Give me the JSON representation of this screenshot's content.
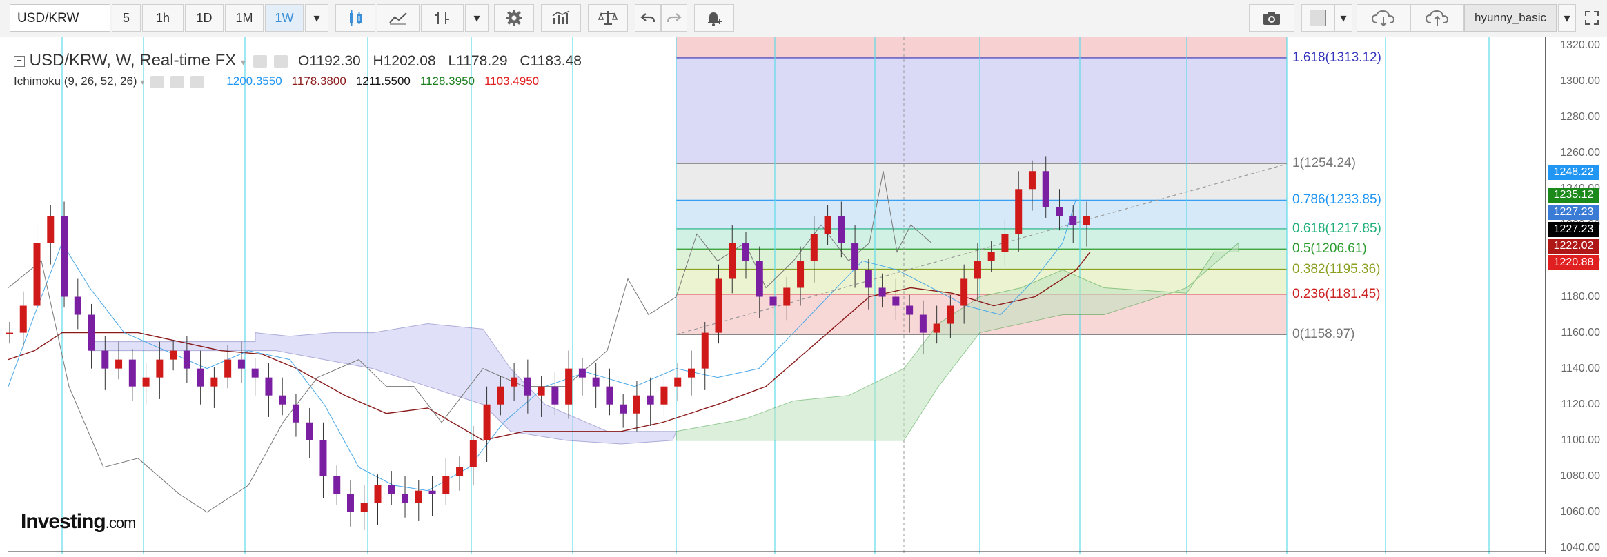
{
  "toolbar": {
    "symbol": "USD/KRW",
    "intervals": [
      "5",
      "1h",
      "1D",
      "1M",
      "1W"
    ],
    "active_interval": "1W",
    "user": "hyunny_basic"
  },
  "legend": {
    "title": "USD/KRW, W, Real-time FX",
    "open_label": "O",
    "open": "1192.30",
    "high_label": "H",
    "high": "1202.08",
    "low_label": "L",
    "low": "1178.29",
    "close_label": "C",
    "close": "1183.48",
    "indicator": "Ichimoku (9, 26, 52, 26)",
    "values": [
      {
        "text": "1200.3550",
        "color": "#2196f3"
      },
      {
        "text": "1178.3800",
        "color": "#8b1a1a"
      },
      {
        "text": "1211.5500",
        "color": "#111111"
      },
      {
        "text": "1128.3950",
        "color": "#1b7d1b"
      },
      {
        "text": "1103.4950",
        "color": "#e02020"
      }
    ]
  },
  "price_axis": {
    "labels": [
      "1320.00",
      "1300.00",
      "1280.00",
      "1260.00",
      "1240.00",
      "1220.00",
      "1200.00",
      "1180.00",
      "1160.00",
      "1140.00",
      "1120.00",
      "1100.00",
      "1080.00",
      "1060.00",
      "1040.00"
    ],
    "tags": [
      {
        "text": "1248.22",
        "color": "#2196f3"
      },
      {
        "text": "1235.12",
        "color": "#1b8a1b"
      },
      {
        "text": "1227.23",
        "color": "#3a7bd5"
      },
      {
        "text": "1227.23",
        "color": "#000000"
      },
      {
        "text": "1222.02",
        "color": "#b01818"
      },
      {
        "text": "1220.88",
        "color": "#e02020"
      }
    ]
  },
  "fibonacci": [
    {
      "level": "1.618(1313.12)",
      "color": "#3333bb"
    },
    {
      "level": "1(1254.24)",
      "color": "#777777"
    },
    {
      "level": "0.786(1233.85)",
      "color": "#2196f3"
    },
    {
      "level": "0.618(1217.85)",
      "color": "#1fb07a"
    },
    {
      "level": "0.5(1206.61)",
      "color": "#2e9b2e"
    },
    {
      "level": "0.382(1195.36)",
      "color": "#8aa020"
    },
    {
      "level": "0.236(1181.45)",
      "color": "#cc2222"
    },
    {
      "level": "0(1158.97)",
      "color": "#777777"
    }
  ],
  "watermark": {
    "brand": "Investing",
    "suffix": ".com"
  },
  "chart_data": {
    "type": "candlestick",
    "symbol": "USD/KRW",
    "interval": "W",
    "ylim": [
      1040,
      1325
    ],
    "approx_close": [
      1160,
      1175,
      1210,
      1225,
      1180,
      1170,
      1150,
      1140,
      1145,
      1130,
      1135,
      1145,
      1150,
      1140,
      1130,
      1135,
      1145,
      1140,
      1135,
      1125,
      1120,
      1110,
      1100,
      1080,
      1070,
      1060,
      1065,
      1075,
      1070,
      1065,
      1072,
      1070,
      1080,
      1085,
      1100,
      1120,
      1130,
      1135,
      1125,
      1130,
      1120,
      1140,
      1135,
      1130,
      1120,
      1115,
      1125,
      1120,
      1130,
      1135,
      1140,
      1160,
      1190,
      1210,
      1200,
      1180,
      1175,
      1185,
      1200,
      1215,
      1225,
      1210,
      1195,
      1185,
      1180,
      1175,
      1170,
      1160,
      1165,
      1175,
      1190,
      1200,
      1205,
      1215,
      1240,
      1250,
      1230,
      1225,
      1220,
      1225
    ]
  }
}
